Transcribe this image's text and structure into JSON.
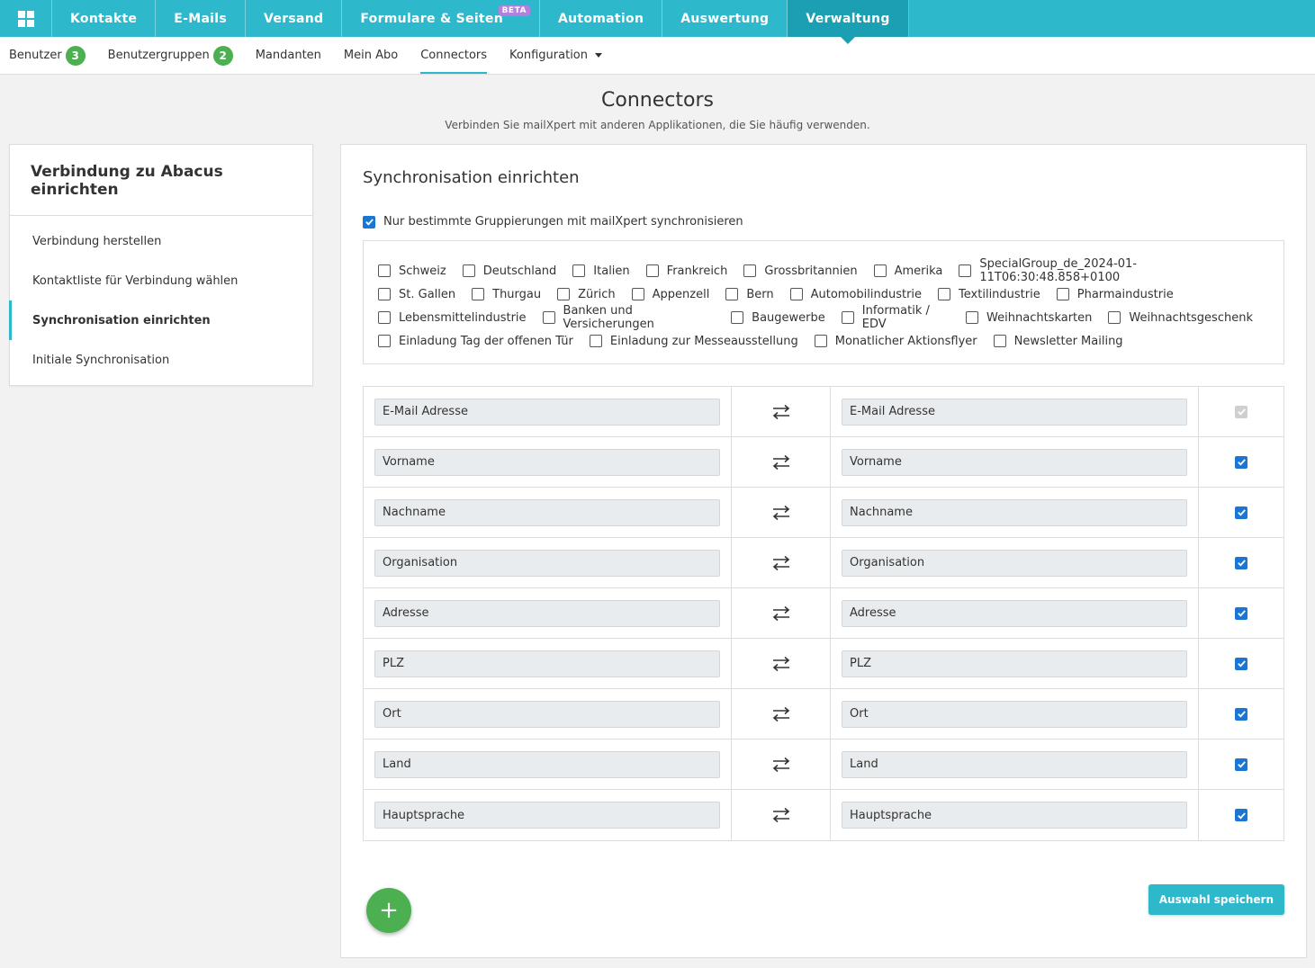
{
  "topnav": {
    "items": [
      {
        "label": "Kontakte"
      },
      {
        "label": "E-Mails"
      },
      {
        "label": "Versand"
      },
      {
        "label": "Formulare & Seiten",
        "badge": "BETA"
      },
      {
        "label": "Automation"
      },
      {
        "label": "Auswertung"
      },
      {
        "label": "Verwaltung",
        "active": true
      }
    ]
  },
  "subnav": {
    "benutzer": {
      "label": "Benutzer",
      "count": "3"
    },
    "benutzergruppen": {
      "label": "Benutzergruppen",
      "count": "2"
    },
    "mandanten": "Mandanten",
    "mein_abo": "Mein Abo",
    "connectors": "Connectors",
    "konfiguration": "Konfiguration"
  },
  "header": {
    "title": "Connectors",
    "subtitle": "Verbinden Sie mailXpert mit anderen Applikationen, die Sie häufig verwenden."
  },
  "sidebar": {
    "title": "Verbindung zu Abacus einrichten",
    "items": [
      {
        "label": "Verbindung herstellen"
      },
      {
        "label": "Kontaktliste für Verbindung wählen"
      },
      {
        "label": "Synchronisation einrichten"
      },
      {
        "label": "Initiale Synchronisation"
      }
    ]
  },
  "main": {
    "title": "Synchronisation einrichten",
    "sync_only_label": "Nur bestimmte Gruppierungen mit mailXpert synchronisieren",
    "groups_rows": [
      [
        "Schweiz",
        "Deutschland",
        "Italien",
        "Frankreich",
        "Grossbritannien",
        "Amerika",
        "SpecialGroup_de_2024-01-11T06:30:48.858+0100"
      ],
      [
        "St. Gallen",
        "Thurgau",
        "Zürich",
        "Appenzell",
        "Bern",
        "Automobilindustrie",
        "Textilindustrie",
        "Pharmaindustrie"
      ],
      [
        "Lebensmittelindustrie",
        "Banken und Versicherungen",
        "Baugewerbe",
        "Informatik / EDV",
        "Weihnachtskarten",
        "Weihnachtsgeschenk"
      ],
      [
        "Einladung Tag der offenen Tür",
        "Einladung zur Messeausstellung",
        "Monatlicher Aktionsflyer",
        "Newsletter Mailing"
      ]
    ],
    "mappings": [
      {
        "left": "E-Mail Adresse",
        "right": "E-Mail Adresse"
      },
      {
        "left": "Vorname",
        "right": "Vorname"
      },
      {
        "left": "Nachname",
        "right": "Nachname"
      },
      {
        "left": "Organisation",
        "right": "Organisation"
      },
      {
        "left": "Adresse",
        "right": "Adresse"
      },
      {
        "left": "PLZ",
        "right": "PLZ"
      },
      {
        "left": "Ort",
        "right": "Ort"
      },
      {
        "left": "Land",
        "right": "Land"
      },
      {
        "left": "Hauptsprache",
        "right": "Hauptsprache"
      }
    ],
    "add_label": "+",
    "save_label": "Auswahl speichern"
  }
}
